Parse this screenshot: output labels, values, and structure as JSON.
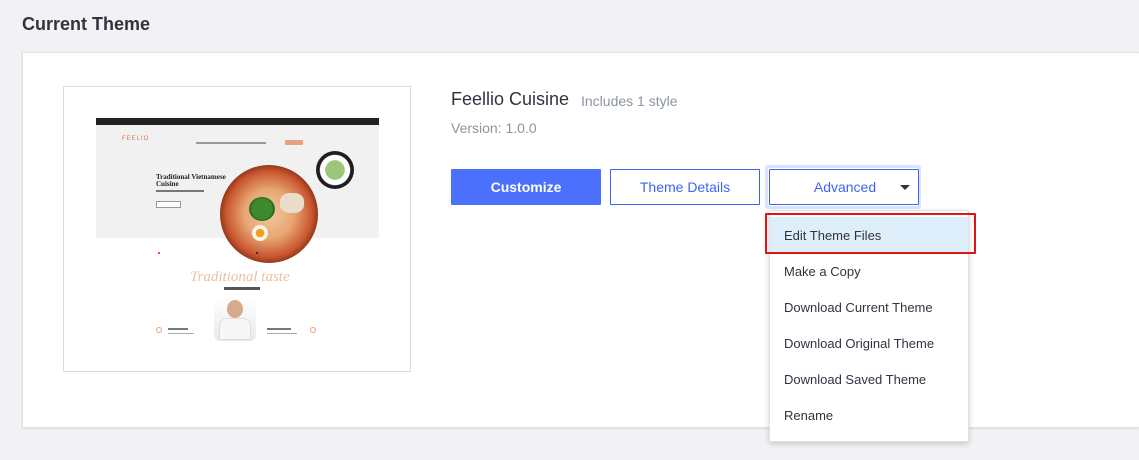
{
  "section": {
    "title": "Current Theme"
  },
  "theme": {
    "name": "Feellio Cuisine",
    "styles_note": "Includes 1 style",
    "version": "Version: 1.0.0"
  },
  "preview": {
    "logo": "FEELIO",
    "headline": "Traditional Vietnamese Cuisine",
    "script_text": "Traditional taste"
  },
  "buttons": {
    "customize": "Customize",
    "theme_details": "Theme Details",
    "advanced": "Advanced"
  },
  "dropdown": {
    "items": [
      {
        "label": "Edit Theme Files",
        "highlighted": true
      },
      {
        "label": "Make a Copy"
      },
      {
        "label": "Download Current Theme"
      },
      {
        "label": "Download Original Theme"
      },
      {
        "label": "Download Saved Theme"
      },
      {
        "label": "Rename"
      }
    ]
  },
  "colors": {
    "primary": "#4b71fc",
    "outline": "#3c64f4",
    "highlight_border": "#e01414",
    "active_item_bg": "#dfeefb"
  }
}
